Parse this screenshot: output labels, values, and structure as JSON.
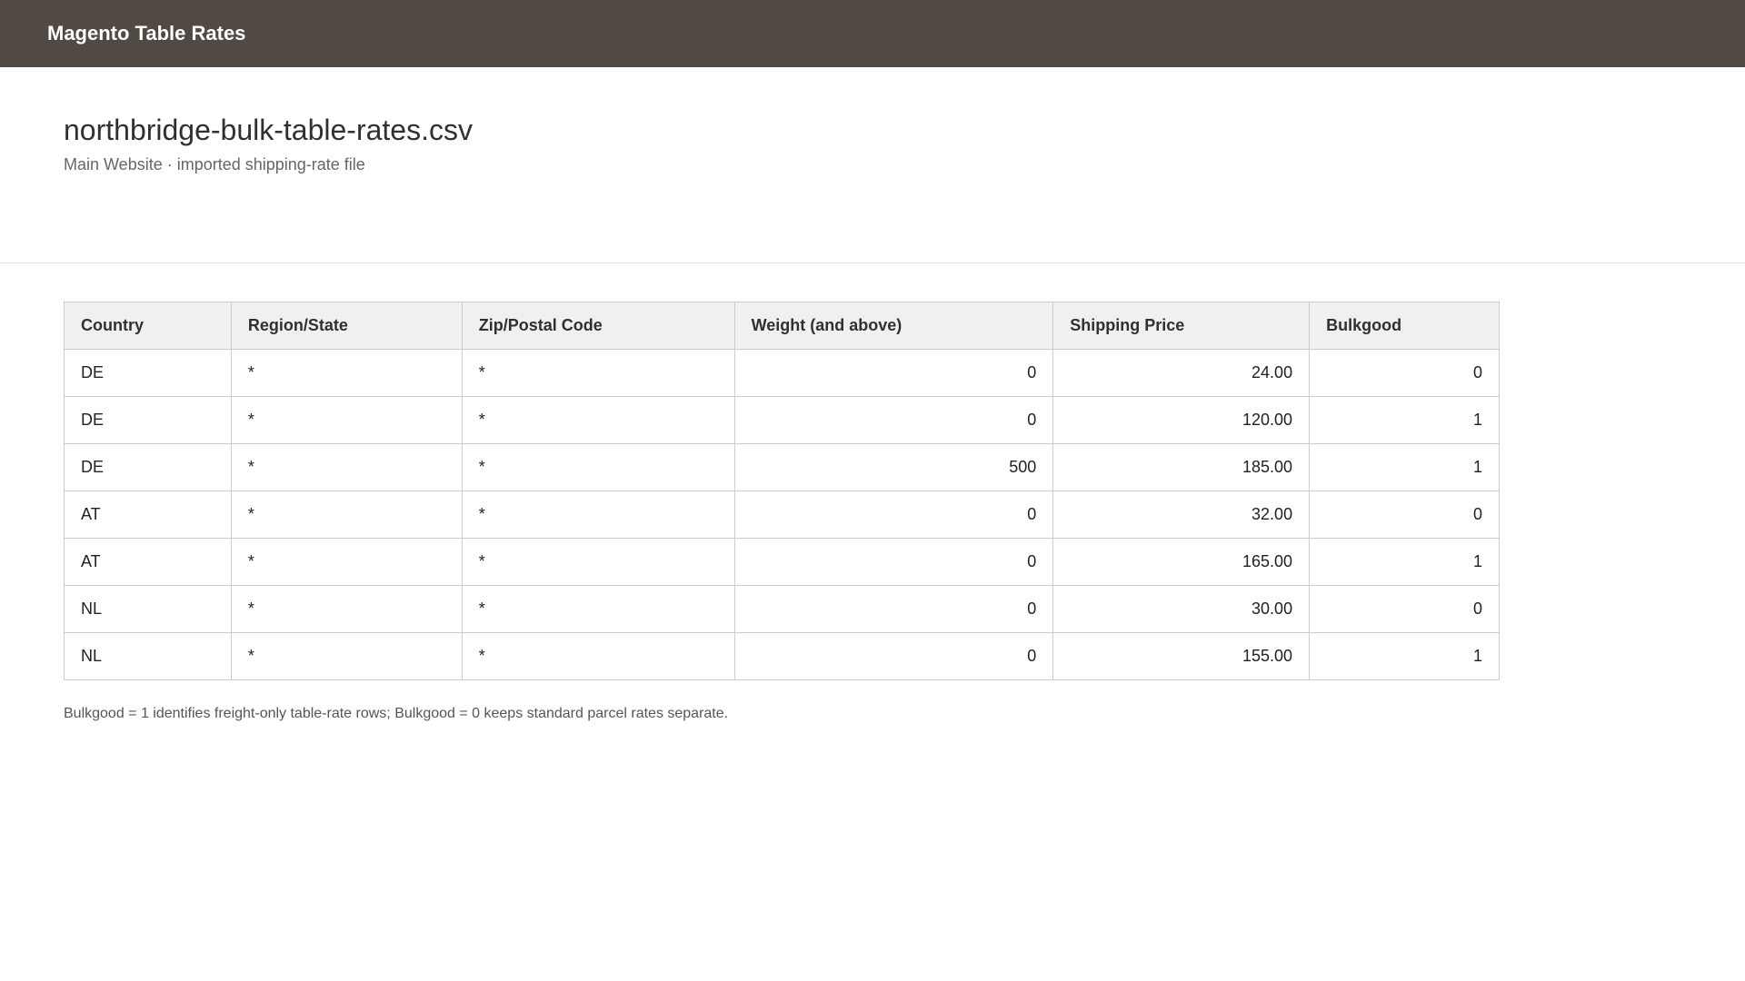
{
  "header": {
    "title": "Magento Table Rates"
  },
  "file": {
    "title": "northbridge-bulk-table-rates.csv",
    "subtitle": "Main Website · imported shipping-rate file"
  },
  "table": {
    "columns": [
      "Country",
      "Region/State",
      "Zip/Postal Code",
      "Weight (and above)",
      "Shipping Price",
      "Bulkgood"
    ],
    "rows": [
      [
        "DE",
        "*",
        "*",
        "0",
        "24.00",
        "0"
      ],
      [
        "DE",
        "*",
        "*",
        "0",
        "120.00",
        "1"
      ],
      [
        "DE",
        "*",
        "*",
        "500",
        "185.00",
        "1"
      ],
      [
        "AT",
        "*",
        "*",
        "0",
        "32.00",
        "0"
      ],
      [
        "AT",
        "*",
        "*",
        "0",
        "165.00",
        "1"
      ],
      [
        "NL",
        "*",
        "*",
        "0",
        "30.00",
        "0"
      ],
      [
        "NL",
        "*",
        "*",
        "0",
        "155.00",
        "1"
      ]
    ]
  },
  "note": "Bulkgood = 1 identifies freight-only table-rate rows; Bulkgood = 0 keeps standard parcel rates separate.",
  "colors": {
    "header_bg": "#514943",
    "table_header_bg": "#f0f0f0",
    "border": "#cccccc"
  }
}
